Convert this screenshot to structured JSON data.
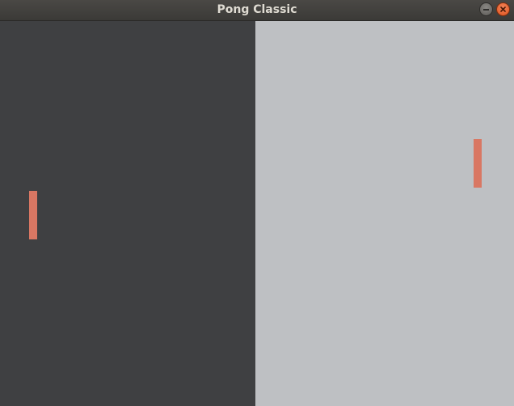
{
  "window": {
    "title": "Pong Classic"
  },
  "controls": {
    "minimize_icon": "minimize-icon",
    "close_icon": "close-icon"
  },
  "colors": {
    "left_court": "#3f4042",
    "right_court": "#bec0c3",
    "paddle": "#d97763"
  }
}
